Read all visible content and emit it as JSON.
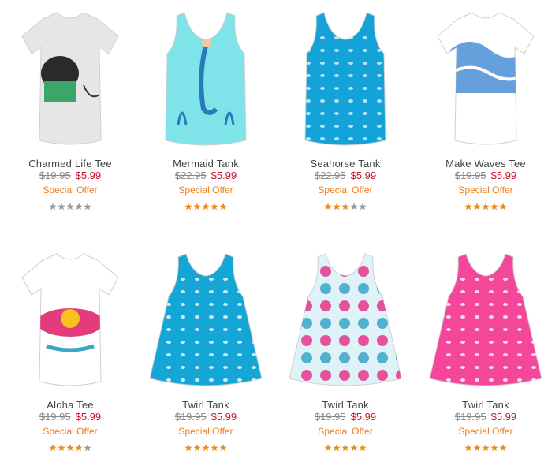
{
  "products": [
    {
      "name": "Charmed Life Tee",
      "was": "$19.95",
      "now": "$5.99",
      "offer": "Special Offer",
      "rating": 0,
      "bg": "#e6e6e6",
      "accent": "#3aa66a",
      "kind": "tee",
      "art": "dog"
    },
    {
      "name": "Mermaid Tank",
      "was": "$22.95",
      "now": "$5.99",
      "offer": "Special Offer",
      "rating": 5,
      "bg": "#7fe4ea",
      "accent": "#2a7ab8",
      "kind": "tank",
      "art": "mermaid"
    },
    {
      "name": "Seahorse Tank",
      "was": "$22.95",
      "now": "$5.99",
      "offer": "Special Offer",
      "rating": 3,
      "bg": "#13a3d8",
      "accent": "#e0f4ff",
      "kind": "tank",
      "art": "seahorse"
    },
    {
      "name": "Make Waves Tee",
      "was": "$19.95",
      "now": "$5.99",
      "offer": "Special Offer",
      "rating": 5,
      "bg": "#ffffff",
      "accent": "#2c6ec4",
      "kind": "tee",
      "art": "waves"
    },
    {
      "name": "Aloha Tee",
      "was": "$19.95",
      "now": "$5.99",
      "offer": "Special Offer",
      "rating": 4,
      "bg": "#ffffff",
      "accent": "#e0266d",
      "kind": "tee",
      "art": "aloha"
    },
    {
      "name": "Twirl Tank",
      "was": "$19.95",
      "now": "$5.99",
      "offer": "Special Offer",
      "rating": 5,
      "bg": "#15a6d8",
      "accent": "#ffffff",
      "kind": "swing",
      "art": "dots"
    },
    {
      "name": "Twirl Tank",
      "was": "$19.95",
      "now": "$5.99",
      "offer": "Special Offer",
      "rating": 5,
      "bg": "#dff2f7",
      "accent": "#e8358d",
      "kind": "swing",
      "art": "floral"
    },
    {
      "name": "Twirl Tank",
      "was": "$19.95",
      "now": "$5.99",
      "offer": "Special Offer",
      "rating": 5,
      "bg": "#f4479a",
      "accent": "#ffffff",
      "kind": "swing",
      "art": "dots"
    }
  ],
  "colors": {
    "star_on": "#ef8a1a",
    "star_off": "#9a9a9a"
  }
}
